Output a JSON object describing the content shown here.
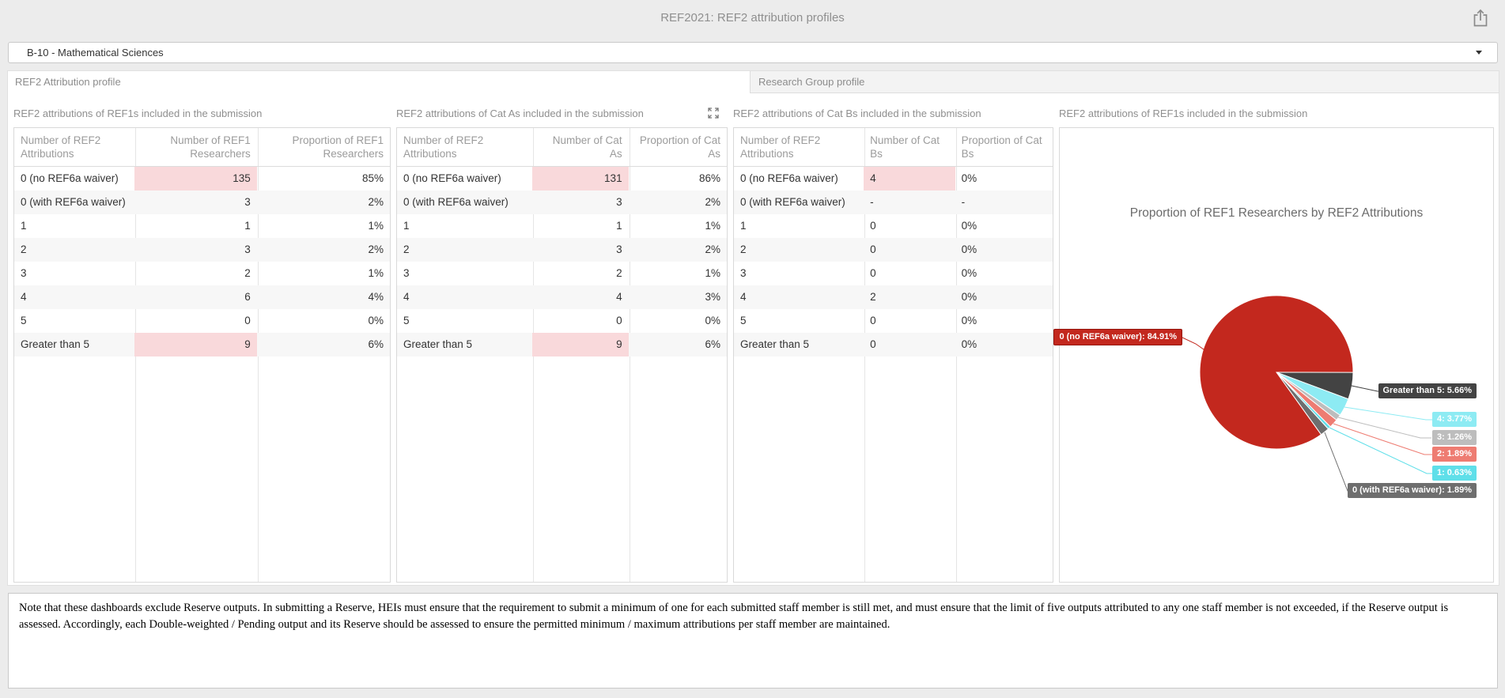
{
  "header": {
    "title": "REF2021: REF2 attribution profiles"
  },
  "uoa_selector": {
    "value": "B-10 - Mathematical Sciences"
  },
  "tabs": [
    {
      "label": "REF2 Attribution profile",
      "active": true
    },
    {
      "label": "Research Group profile",
      "active": false
    }
  ],
  "theme": {
    "highlight_pink": "#f9d9db",
    "accent_red": "#c3281e"
  },
  "tables": [
    {
      "title": "REF2 attributions of REF1s included in the submission",
      "columns": [
        "Number of REF2 Attributions",
        "Number of REF1 Researchers",
        "Proportion of REF1 Researchers"
      ],
      "rows": [
        [
          "0 (no REF6a waiver)",
          "135",
          "85%"
        ],
        [
          "0 (with REF6a waiver)",
          "3",
          "2%"
        ],
        [
          "1",
          "1",
          "1%"
        ],
        [
          "2",
          "3",
          "2%"
        ],
        [
          "3",
          "2",
          "1%"
        ],
        [
          "4",
          "6",
          "4%"
        ],
        [
          "5",
          "0",
          "0%"
        ],
        [
          "Greater than 5",
          "9",
          "6%"
        ]
      ],
      "highlighted_cells": [
        [
          0,
          1
        ],
        [
          7,
          1
        ]
      ]
    },
    {
      "title": "REF2 attributions of Cat As included in the submission",
      "columns": [
        "Number of REF2 Attributions",
        "Number of Cat As",
        "Proportion of Cat As"
      ],
      "rows": [
        [
          "0 (no REF6a waiver)",
          "131",
          "86%"
        ],
        [
          "0 (with REF6a waiver)",
          "3",
          "2%"
        ],
        [
          "1",
          "1",
          "1%"
        ],
        [
          "2",
          "3",
          "2%"
        ],
        [
          "3",
          "2",
          "1%"
        ],
        [
          "4",
          "4",
          "3%"
        ],
        [
          "5",
          "0",
          "0%"
        ],
        [
          "Greater than 5",
          "9",
          "6%"
        ]
      ],
      "highlighted_cells": [
        [
          0,
          1
        ],
        [
          7,
          1
        ]
      ]
    },
    {
      "title": "REF2 attributions of Cat Bs included in the submission",
      "columns": [
        "Number of REF2 Attributions",
        "Number of Cat Bs",
        "Proportion of Cat Bs"
      ],
      "rows": [
        [
          "0 (no REF6a waiver)",
          "4",
          "0%"
        ],
        [
          "0 (with REF6a waiver)",
          "-",
          "-"
        ],
        [
          "1",
          "0",
          "0%"
        ],
        [
          "2",
          "0",
          "0%"
        ],
        [
          "3",
          "0",
          "0%"
        ],
        [
          "4",
          "2",
          "0%"
        ],
        [
          "5",
          "0",
          "0%"
        ],
        [
          "Greater than 5",
          "0",
          "0%"
        ]
      ],
      "highlighted_cells": [
        [
          0,
          1
        ]
      ]
    }
  ],
  "chart_data": {
    "type": "pie",
    "panel_title": "REF2 attributions of REF1s included in the submission",
    "title": "Proportion of REF1 Researchers by REF2 Attributions",
    "legend_position": "none",
    "slices": [
      {
        "label": "0 (no REF6a waiver)",
        "value": 84.91,
        "color": "#c3281e",
        "callout": "0 (no REF6a waiver): 84.91%"
      },
      {
        "label": "0 (with REF6a waiver)",
        "value": 1.89,
        "color": "#6e6e6e",
        "callout": "0 (with REF6a waiver): 1.89%"
      },
      {
        "label": "1",
        "value": 0.63,
        "color": "#5fdfe9",
        "callout": "1: 0.63%"
      },
      {
        "label": "2",
        "value": 1.89,
        "color": "#ee7c72",
        "callout": "2: 1.89%"
      },
      {
        "label": "3",
        "value": 1.26,
        "color": "#bdbdbd",
        "callout": "3: 1.26%"
      },
      {
        "label": "4",
        "value": 3.77,
        "color": "#8debf3",
        "callout": "4: 3.77%"
      },
      {
        "label": "Greater than 5",
        "value": 5.66,
        "color": "#434343",
        "callout": "Greater than 5: 5.66%"
      }
    ]
  },
  "note": "Note that these dashboards exclude Reserve outputs. In submitting a Reserve, HEIs must ensure that the requirement to submit a minimum of one for each submitted staff member is still met, and must ensure that the limit of five outputs attributed to any one staff member is not exceeded, if the Reserve output is assessed. Accordingly, each Double-weighted / Pending output and its Reserve should be assessed to ensure the permitted minimum / maximum attributions per staff member are maintained."
}
